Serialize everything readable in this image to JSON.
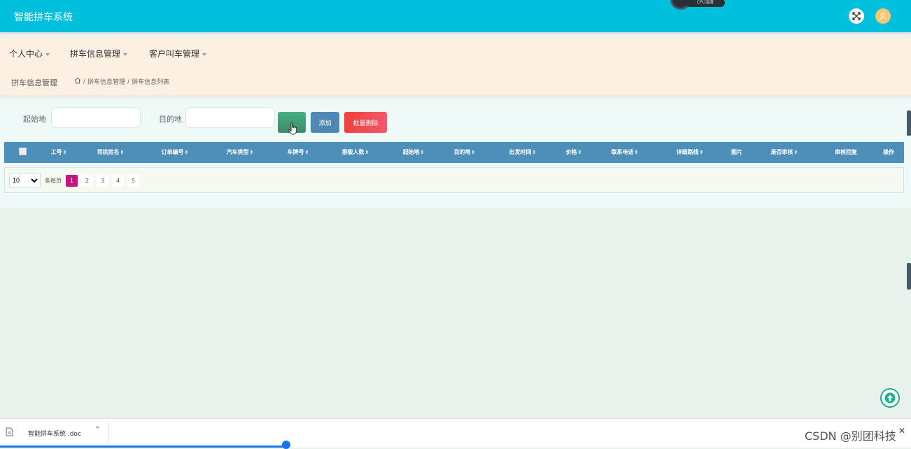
{
  "app": {
    "title": "智能拼车系统",
    "cpu_label": "CPU温度"
  },
  "nav": {
    "items": [
      {
        "label": "个人中心"
      },
      {
        "label": "拼车信息管理"
      },
      {
        "label": "客户叫车管理"
      }
    ]
  },
  "breadcrumb": {
    "title": "拼车信息管理",
    "path": [
      "拼车信息管理",
      "拼车信息列表"
    ],
    "separator": "/"
  },
  "search": {
    "start_label": "起始地",
    "start_value": "",
    "start_placeholder": "",
    "dest_label": "目的地",
    "dest_value": "",
    "dest_placeholder": "",
    "search_button": "",
    "add_button": "添加",
    "batch_delete_button": "批量删除"
  },
  "table": {
    "columns": [
      "工号",
      "司机姓名",
      "订单编号",
      "汽车类型",
      "车牌号",
      "搭载人数",
      "起始地",
      "目的地",
      "出发时间",
      "价格",
      "联系电话",
      "详细路线",
      "图片",
      "是否审核",
      "审核回复",
      "操作"
    ],
    "sortable": [
      true,
      true,
      true,
      true,
      true,
      true,
      true,
      true,
      true,
      true,
      true,
      true,
      false,
      true,
      false,
      false
    ],
    "rows": []
  },
  "pagination": {
    "page_size": "10",
    "page_size_options": [
      "10"
    ],
    "per_page_label": "条每页",
    "pages": [
      "1",
      "2",
      "3",
      "4",
      "5"
    ],
    "current_page": 1
  },
  "download": {
    "file_name": "智能拼车系统 .doc"
  },
  "watermark": "CSDN @别团科技",
  "colors": {
    "header": "#00c0de",
    "table_header": "#4d8fb8",
    "active_page": "#c3177f",
    "add_button": "#4f89b3",
    "delete_button": "#f1413b"
  }
}
